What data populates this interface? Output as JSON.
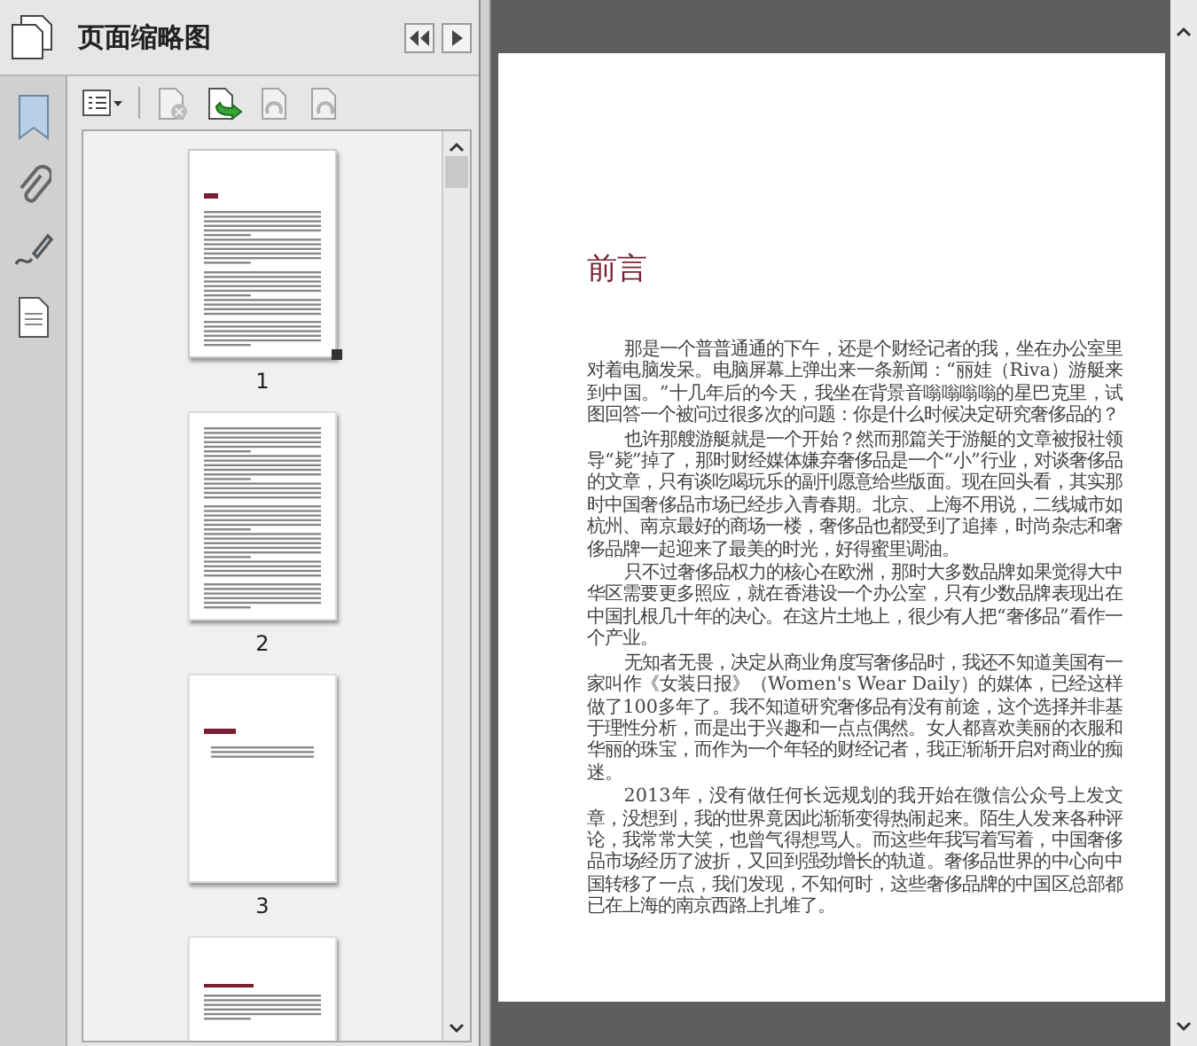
{
  "panel": {
    "title": "页面缩略图"
  },
  "toolbar": {
    "tools": [
      {
        "kind": "delete",
        "disabled": true
      },
      {
        "kind": "insert",
        "disabled": false
      },
      {
        "kind": "rotate-left",
        "disabled": true
      },
      {
        "kind": "rotate-right",
        "disabled": true
      }
    ]
  },
  "thumbnails": [
    {
      "label": "1",
      "kind": "full-text",
      "selected": true
    },
    {
      "label": "2",
      "kind": "dense-text",
      "selected": false
    },
    {
      "label": "3",
      "kind": "part-title",
      "selected": false
    },
    {
      "kind": "section-text",
      "selected": false
    }
  ],
  "document": {
    "heading": "前言",
    "paragraphs": [
      "那是一个普普通通的下午，还是个财经记者的我，坐在办公室里对着电脑发呆。电脑屏幕上弹出来一条新闻：“丽娃（Riva）游艇来到中国。”十几年后的今天，我坐在背景音嗡嗡嗡嗡的星巴克里，试图回答一个被问过很多次的问题：你是什么时候决定研究奢侈品的？",
      "也许那艘游艇就是一个开始？然而那篇关于游艇的文章被报社领导“毙”掉了，那时财经媒体嫌弃奢侈品是一个“小”行业，对谈奢侈品的文章，只有谈吃喝玩乐的副刊愿意给些版面。现在回头看，其实那时中国奢侈品市场已经步入青春期。北京、上海不用说，二线城市如杭州、南京最好的商场一楼，奢侈品也都受到了追捧，时尚杂志和奢侈品牌一起迎来了最美的时光，好得蜜里调油。",
      "只不过奢侈品权力的核心在欧洲，那时大多数品牌如果觉得大中华区需要更多照应，就在香港设一个办公室，只有少数品牌表现出在中国扎根几十年的决心。在这片土地上，很少有人把“奢侈品”看作一个产业。",
      "无知者无畏，决定从商业角度写奢侈品时，我还不知道美国有一家叫作《女装日报》（Women's Wear Daily）的媒体，已经这样做了100多年了。我不知道研究奢侈品有没有前途，这个选择并非基于理性分析，而是出于兴趣和一点点偶然。女人都喜欢美丽的衣服和华丽的珠宝，而作为一个年轻的财经记者，我正渐渐开启对商业的痴迷。",
      "2013年，没有做任何长远规划的我开始在微信公众号上发文章，没想到，我的世界竟因此渐渐变得热闹起来。陌生人发来各种评论，我常常大笑，也曾气得想骂人。而这些年我写着写着，中国奢侈品市场经历了波折，又回到强劲增长的轨道。奢侈品世界的中心向中国转移了一点，我们发现，不知何时，这些奢侈品牌的中国区总部都已在上海的南京西路上扎堆了。"
    ]
  }
}
